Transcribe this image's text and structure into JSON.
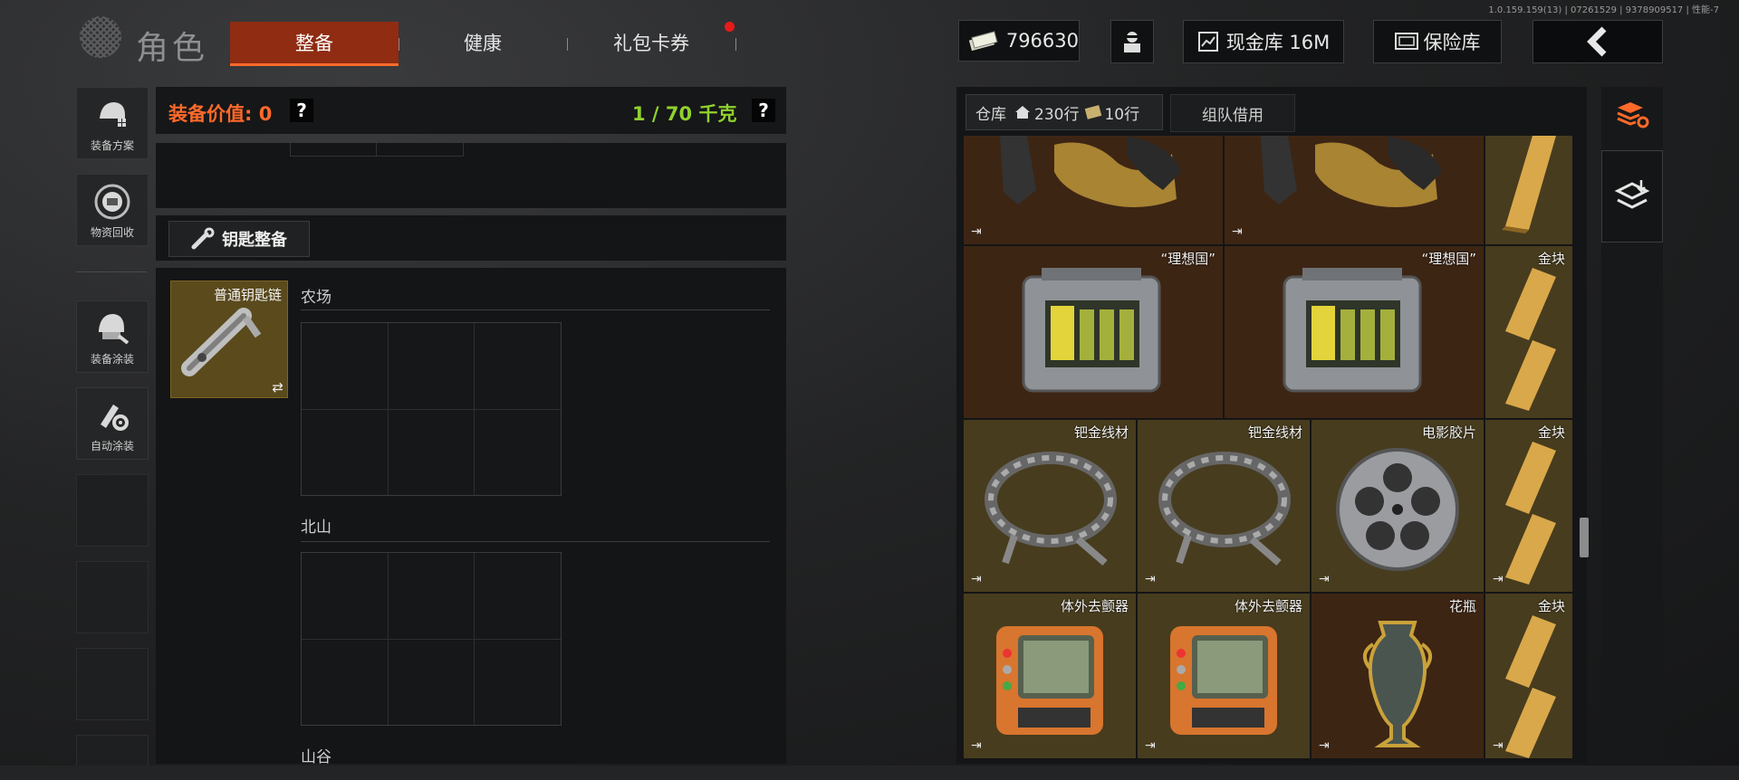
{
  "header": {
    "version": "1.0.159.159(13) | 07261529 | 9378909517 | 性能-7",
    "role_title": "角色",
    "tabs": [
      {
        "label": "整备",
        "active": true
      },
      {
        "label": "健康",
        "active": false
      },
      {
        "label": "礼包卡券",
        "active": false,
        "notification": true
      }
    ],
    "currency": {
      "amount": "796630"
    },
    "cash_vault": {
      "label": "现金库 16M"
    },
    "safe": {
      "label": "保险库"
    }
  },
  "sidebar": {
    "items": [
      {
        "label": "装备方案"
      },
      {
        "label": "物资回收"
      },
      {
        "label": "装备涂装"
      },
      {
        "label": "自动涂装"
      }
    ]
  },
  "equipment": {
    "value_label": "装备价值: 0",
    "weight_label": "1 / 70 千克",
    "help": "?",
    "key_section_label": "钥匙整备",
    "keychain_name": "普通钥匙链",
    "swap_symbol": "⇄",
    "areas": [
      {
        "title": "农场"
      },
      {
        "title": "北山"
      },
      {
        "title": "山谷"
      }
    ]
  },
  "storage": {
    "tabs": {
      "warehouse": "仓库",
      "rows": "230行",
      "ticket_rows": "10行",
      "team_loan": "组队借用"
    },
    "items": {
      "row1_a": "",
      "row1_b": "",
      "ideal_1": "“理想国”",
      "ideal_2": "“理想国”",
      "gold_1": "金块",
      "wire_1": "钯金线材",
      "wire_2": "钯金线材",
      "film": "电影胶片",
      "gold_2": "金块",
      "defib_1": "体外去颤器",
      "defib_2": "体外去颤器",
      "vase": "花瓶",
      "gold_3": "金块"
    },
    "out_symbol": "⇥"
  },
  "colors": {
    "accent": "#ff6a2a",
    "tab_active": "#8f2c12",
    "weight_green": "#8fd12e",
    "value_orange": "#ff6a2a",
    "gold_bg": "#473c1e",
    "brown_bg": "#3d2514"
  }
}
